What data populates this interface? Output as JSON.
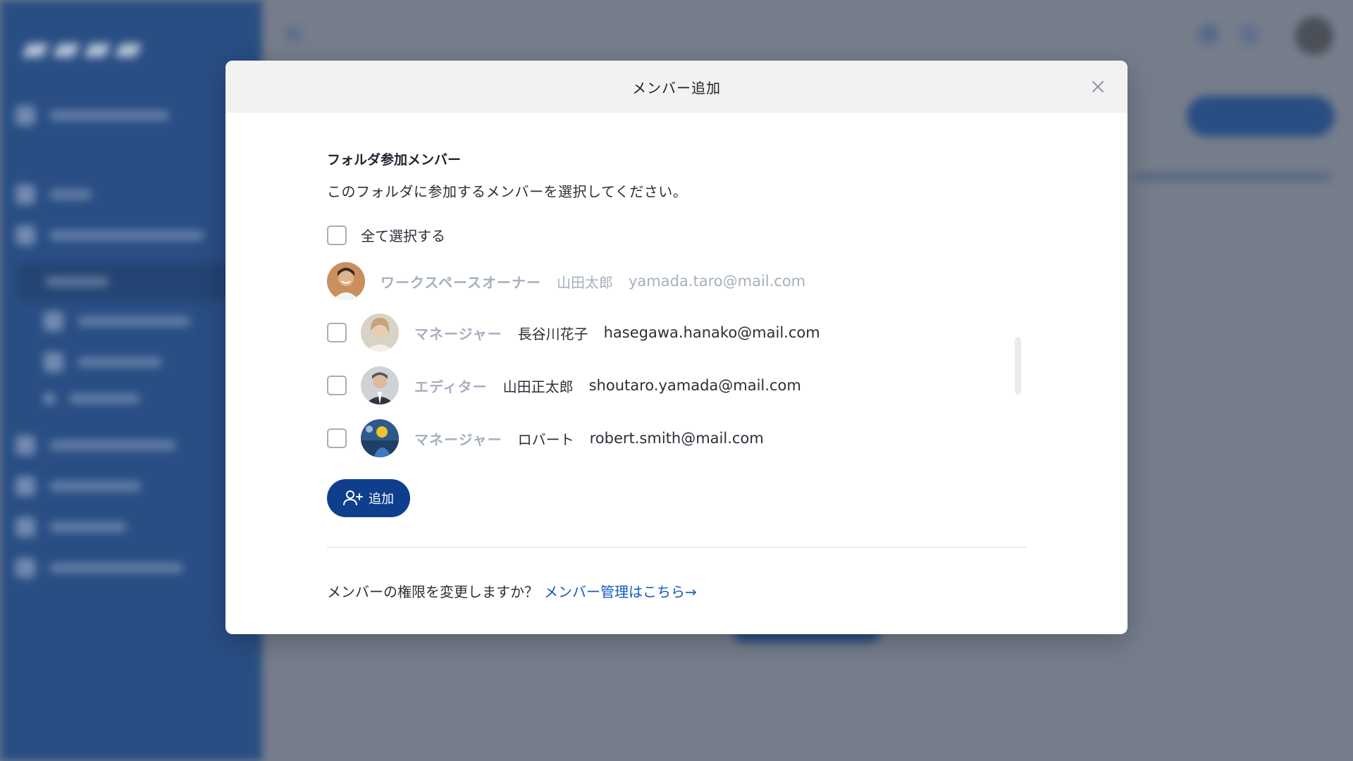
{
  "modal": {
    "title": "メンバー追加",
    "section_title": "フォルダ参加メンバー",
    "section_description": "このフォルダに参加するメンバーを選択してください。",
    "select_all_label": "全て選択する",
    "add_button_label": "追加",
    "footer_question": "メンバーの権限を変更しますか？",
    "footer_link": "メンバー管理はこちら→"
  },
  "members": [
    {
      "role": "ワークスペースオーナー",
      "name": "山田太郎",
      "email": "yamada.taro@mail.com",
      "selectable": false
    },
    {
      "role": "マネージャー",
      "name": "長谷川花子",
      "email": "hasegawa.hanako@mail.com",
      "selectable": true
    },
    {
      "role": "エディター",
      "name": "山田正太郎",
      "email": "shoutaro.yamada@mail.com",
      "selectable": true
    },
    {
      "role": "マネージャー",
      "name": "ロバート",
      "email": "robert.smith@mail.com",
      "selectable": true
    }
  ],
  "icons": {
    "close": "close-icon",
    "add_user": "user-plus-icon"
  },
  "colors": {
    "primary": "#0f3f8c",
    "link": "#1558c0",
    "role_text": "#a6afbe",
    "sidebar": "#294e84",
    "overlay": "#767d8b"
  }
}
